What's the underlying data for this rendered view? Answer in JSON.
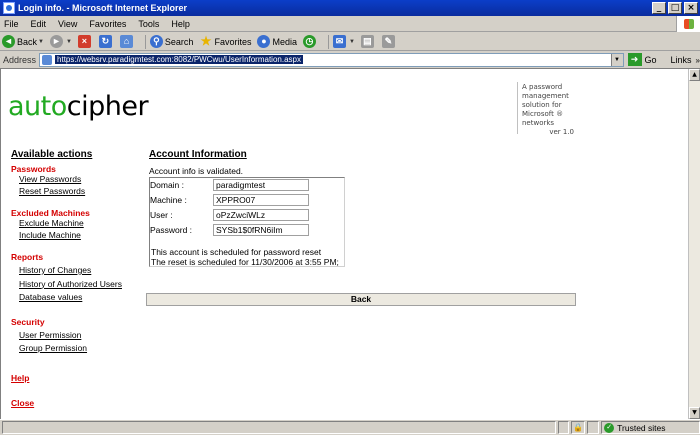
{
  "window": {
    "title": "Login info. - Microsoft Internet Explorer"
  },
  "menu": [
    "File",
    "Edit",
    "View",
    "Favorites",
    "Tools",
    "Help"
  ],
  "toolbar": {
    "back": "Back",
    "search": "Search",
    "favorites": "Favorites",
    "media": "Media"
  },
  "address": {
    "label": "Address",
    "url": "https://websrv.paradigmtest.com:8082/PWCwu/UserInformation.aspx",
    "go": "Go",
    "links": "Links"
  },
  "logo": {
    "part1": "auto",
    "part2": "cipher"
  },
  "tagline": {
    "text": "A password management solution for Microsoft ® networks",
    "version": "ver 1.0"
  },
  "sidebar": {
    "title": "Available actions",
    "sections": [
      {
        "heading": "Passwords",
        "links": [
          "View Passwords",
          "Reset Passwords"
        ]
      },
      {
        "heading": "Excluded Machines",
        "links": [
          "Exclude Machine",
          "Include Machine"
        ]
      },
      {
        "heading": "Reports",
        "links": [
          "History of Changes",
          "History of Authorized Users",
          "Database values"
        ]
      },
      {
        "heading": "Security",
        "links": [
          "User Permission",
          "Group Permission"
        ]
      }
    ],
    "help": "Help",
    "close": "Close"
  },
  "account": {
    "title": "Account Information",
    "validated": "Account info is validated.",
    "fields": [
      {
        "label": "Domain :",
        "value": "paradigmtest"
      },
      {
        "label": "Machine :",
        "value": "XPPRO07"
      },
      {
        "label": "User :",
        "value": "oPzZwciWLz"
      },
      {
        "label": "Password :",
        "value": "SYSb1$0fRN6iIm"
      }
    ],
    "note1": "This account is scheduled for password reset",
    "note2": "The reset is scheduled for 11/30/2006 at 3:55 PM;",
    "back_button": "Back"
  },
  "status": {
    "zone": "Trusted sites"
  }
}
